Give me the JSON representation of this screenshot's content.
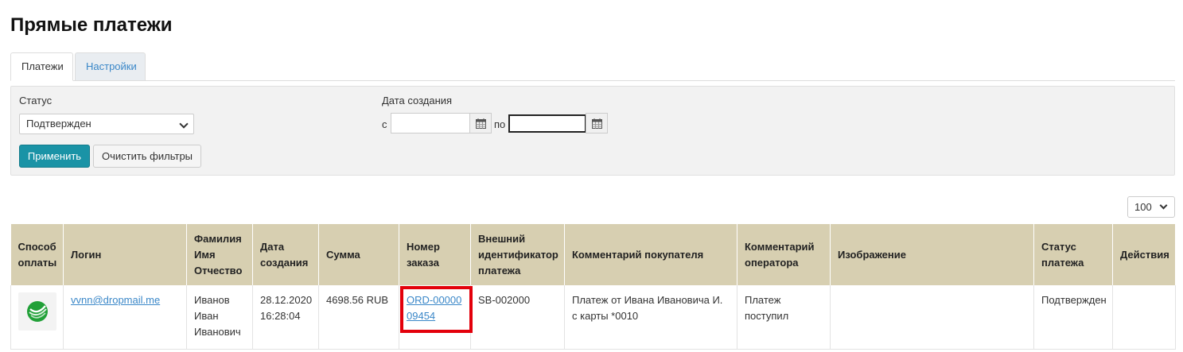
{
  "page": {
    "title": "Прямые платежи"
  },
  "tabs": [
    {
      "label": "Платежи",
      "active": true
    },
    {
      "label": "Настройки",
      "active": false
    }
  ],
  "filters": {
    "status_label": "Статус",
    "status_value": "Подтвержден",
    "date_label": "Дата создания",
    "from_label": "с",
    "to_label": "по",
    "from_value": "",
    "to_value": "",
    "apply_label": "Применить",
    "clear_label": "Очистить фильтры"
  },
  "pagination": {
    "per_page": "100"
  },
  "table": {
    "columns": [
      "Способ оплаты",
      "Логин",
      "Фамилия Имя Отчество",
      "Дата создания",
      "Сумма",
      "Номер заказа",
      "Внешний идентификатор платежа",
      "Комментарий покупателя",
      "Комментарий оператора",
      "Изображение",
      "Статус платежа",
      "Действия"
    ],
    "rows": [
      {
        "payment_method_icon": "sberbank-logo-icon",
        "login": "vvnn@dropmail.me",
        "full_name": "Иванов Иван Иванович",
        "created": "28.12.2020 16:28:04",
        "amount": "4698.56 RUB",
        "order_number": "ORD-0000009454",
        "external_id": "SB-002000",
        "customer_comment": "Платеж от Ивана Ивановича И. с карты *0010",
        "operator_comment": "Платеж поступил",
        "image": "",
        "status": "Подтвержден",
        "actions": ""
      }
    ]
  },
  "colors": {
    "header_bg": "#d7cfb1",
    "primary_button": "#1a93a6",
    "link": "#3a87c8",
    "highlight": "#e3000b",
    "sber_green": "#21a038"
  }
}
